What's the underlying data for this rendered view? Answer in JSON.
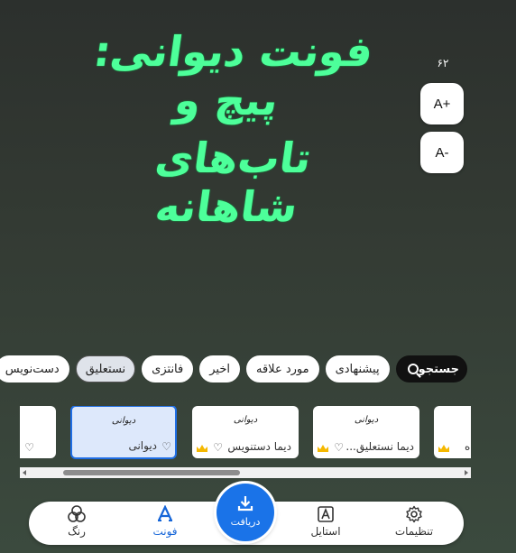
{
  "preview": {
    "line1": "فونت دیوانی: پیچ و",
    "line2": "تاب‌های شاهانه",
    "color": "#4dff9a"
  },
  "size_controls": {
    "current_size": "۶۲",
    "increase_label": "A+",
    "decrease_label": "A-"
  },
  "filters": [
    {
      "label": "جستجو",
      "type": "search"
    },
    {
      "label": "پیشنهادی"
    },
    {
      "label": "مورد علاقه"
    },
    {
      "label": "اخیر"
    },
    {
      "label": "فانتزی"
    },
    {
      "label": "نستعلیق",
      "selected": true
    },
    {
      "label": "دست‌نویس"
    }
  ],
  "font_cards": [
    {
      "name": "",
      "sample": "",
      "premium": false,
      "partial": true
    },
    {
      "name": "دیوانی",
      "sample": "دیوانی",
      "premium": false,
      "selected": true
    },
    {
      "name": "دیما دستنویس",
      "sample": "دیوانی",
      "premium": true
    },
    {
      "name": "دیما نستعلیق...",
      "sample": "دیوانی",
      "premium": true
    },
    {
      "name": "ه",
      "sample": "",
      "premium": true,
      "partial": true
    }
  ],
  "bottom_nav": {
    "color": "رنگ",
    "font": "فونت",
    "download": "دریافت",
    "style": "استایل",
    "settings": "تنظیمات"
  },
  "colors": {
    "accent": "#1a73e8",
    "preview_text": "#4dff9a",
    "premium_crown": "#f5b800"
  }
}
